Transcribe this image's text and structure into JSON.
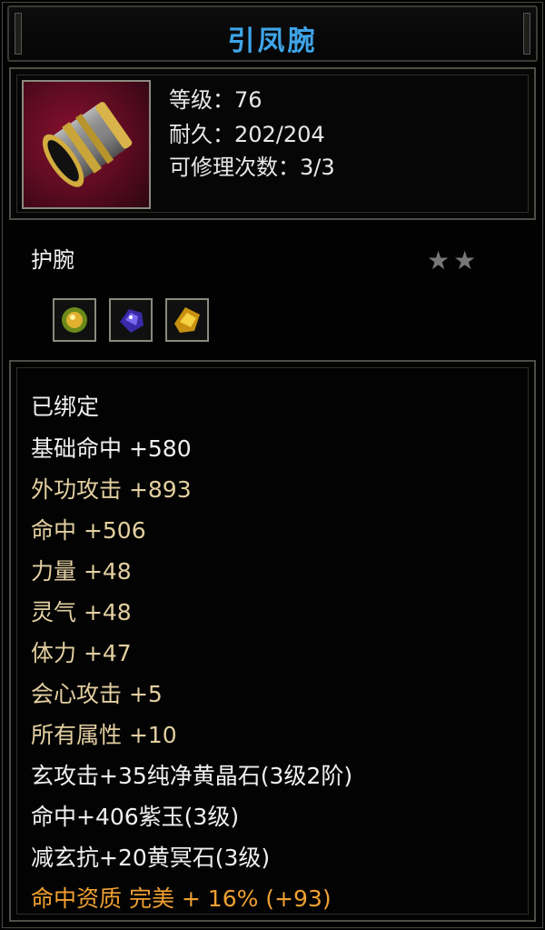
{
  "item": {
    "name": "引凤腕",
    "level": "等级：76",
    "durability": "耐久：202/204",
    "repairs": "可修理次数：3/3",
    "type": "护腕",
    "stars": "★★",
    "gems": [
      {
        "icon": "yellow-green-gem-icon"
      },
      {
        "icon": "purple-jade-gem-icon"
      },
      {
        "icon": "yellow-crystal-gem-icon"
      }
    ]
  },
  "stats": {
    "bound": "已绑定",
    "lines": [
      "基础命中  +580",
      "外功攻击  +893",
      "命中  +506",
      "力量  +48",
      "灵气  +48",
      "体力  +47",
      "会心攻击  +5",
      "所有属性  +10"
    ],
    "gem_lines": [
      "玄攻击+35纯净黄晶石(3级2阶)",
      "命中+406紫玉(3级)",
      "减玄抗+20黄冥石(3级)"
    ],
    "quality": "命中资质  完美  +  16%  (+93)"
  },
  "colors": {
    "title": "#3fa4e8",
    "white_text": "#f0f0f0",
    "tan_text": "#e2cfa0",
    "orange_text": "#f0a032",
    "icon_bg": "#8a1030"
  }
}
